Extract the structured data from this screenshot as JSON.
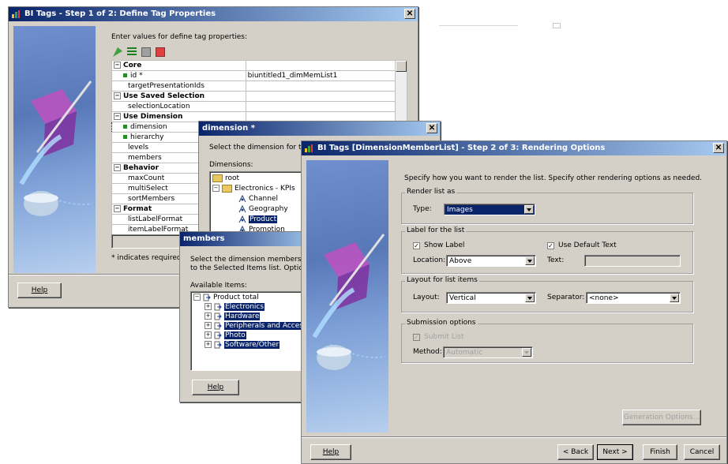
{
  "win1": {
    "title": "BI Tags - Step 1 of 2: Define Tag Properties",
    "instruction": "Enter values for define tag properties:",
    "categories": {
      "core": "Core",
      "saved": "Use Saved Selection",
      "dimension": "Use Dimension",
      "behavior": "Behavior",
      "format": "Format"
    },
    "props": {
      "id": "id *",
      "id_value": "biuntitled1_dimMemList1",
      "targetPresentationIds": "targetPresentationIds",
      "selectionLocation": "selectionLocation",
      "dimension": "dimension",
      "hierarchy": "hierarchy",
      "levels": "levels",
      "members": "members",
      "maxCount": "maxCount",
      "multiSelect": "multiSelect",
      "sortMembers": "sortMembers",
      "listLabelFormat": "listLabelFormat",
      "itemLabelFormat": "itemLabelFormat"
    },
    "required_note": "* indicates required",
    "help": "Help"
  },
  "win2": {
    "title": "dimension *",
    "instruction": "Select the dimension for the lis",
    "dimensions_label": "Dimensions:",
    "tree": [
      "root",
      "Electronics - KPIs",
      "Channel",
      "Geography",
      "Product",
      "Promotion"
    ]
  },
  "win3": {
    "title": "members",
    "instruction_1": "Select the dimension members that y",
    "instruction_2": "to the Selected Items list. Optionally",
    "available_label": "Available Items:",
    "items": [
      "Product total",
      "Electronics",
      "Hardware",
      "Peripherals and Accessor",
      "Photo",
      "Software/Other"
    ],
    "help": "Help"
  },
  "win4": {
    "title": "BI Tags [DimensionMemberList] - Step 2 of 3: Rendering Options",
    "instruction": "Specify how you want to render the list. Specify other rendering options as needed.",
    "render_group": "Render list as",
    "type_label": "Type:",
    "type_value": "Images",
    "label_group": "Label for the list",
    "show_label": "Show Label",
    "use_default_text": "Use Default Text",
    "location_label": "Location:",
    "location_value": "Above",
    "text_label": "Text:",
    "layout_group": "Layout for list items",
    "layout_label": "Layout:",
    "layout_value": "Vertical",
    "separator_label": "Separator:",
    "separator_value": "<none>",
    "submission_group": "Submission options",
    "submit_list": "Submit List",
    "method_label": "Method:",
    "method_value": "Automatic",
    "generation_options": "Generation Options...",
    "help": "Help",
    "back": "< Back",
    "next": "Next >",
    "finish": "Finish",
    "cancel": "Cancel"
  }
}
